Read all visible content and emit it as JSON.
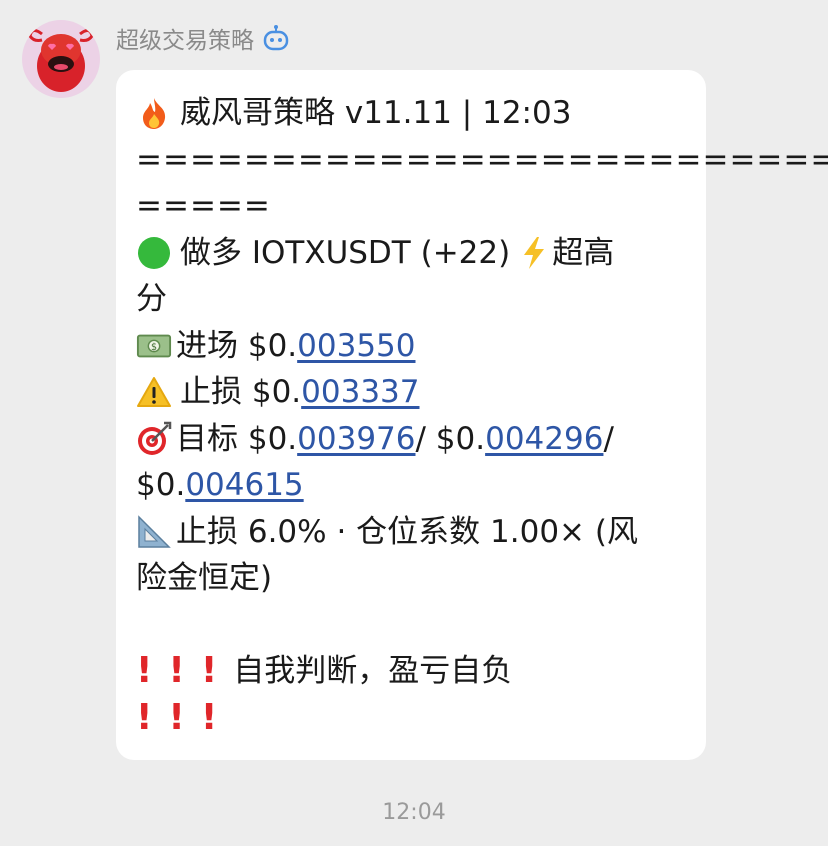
{
  "chat": {
    "sender_name": "超级交易策略",
    "timestamp": "12:04"
  },
  "message": {
    "title_line": "威风哥策略 v11.11 | 12:03",
    "separator_1": "==========================",
    "separator_2": "=====",
    "signal_line_1": "做多 IOTXUSDT (+22)",
    "signal_tag": "超高",
    "signal_line_2": "分",
    "entry_label": "进场 $0.",
    "entry_value": "003550",
    "stop_label": "止损 $0.",
    "stop_value": "003337",
    "target_label": "目标 $0.",
    "target_1": "003976",
    "target_sep": " / $0.",
    "target_2": "004296",
    "target_sep_2": " /",
    "target_3_prefix": "$0.",
    "target_3": "004615",
    "risk_line_1": "止损 6.0% · 仓位系数 1.00× (风",
    "risk_line_2": "险金恒定)",
    "warning_text": "自我判断，盈亏自负",
    "bang": "!"
  },
  "icons": {
    "fire": "fire-emoji",
    "green_circle": "green-circle-emoji",
    "lightning": "lightning-emoji",
    "money": "money-emoji",
    "warning": "warning-emoji",
    "target": "bullseye-emoji",
    "ruler": "triangle-ruler-emoji"
  },
  "colors": {
    "link": "#2e56a6",
    "bang": "#e0262a",
    "green": "#35b93c",
    "lightning": "#f6c026"
  }
}
